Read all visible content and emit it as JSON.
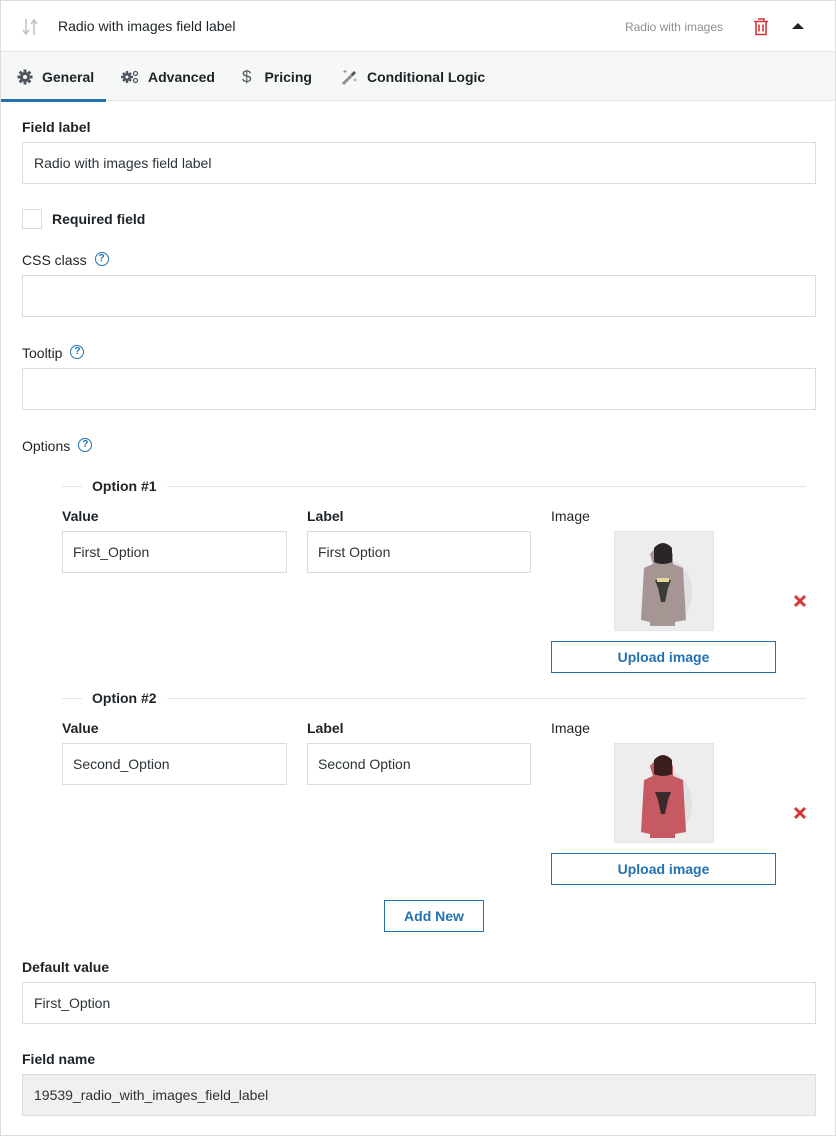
{
  "header": {
    "title": "Radio with images field label",
    "field_type": "Radio with images",
    "icons": {
      "sort": "sort-arrows-icon",
      "delete": "trash-icon",
      "collapse": "caret-up-icon"
    }
  },
  "tabs": [
    {
      "label": "General",
      "icon": "gear-icon",
      "active": true
    },
    {
      "label": "Advanced",
      "icon": "gears-icon",
      "active": false
    },
    {
      "label": "Pricing",
      "icon": "dollar-icon",
      "active": false
    },
    {
      "label": "Conditional Logic",
      "icon": "magic-wand-icon",
      "active": false
    }
  ],
  "form": {
    "field_label": {
      "label": "Field label",
      "value": "Radio with images field label"
    },
    "required": {
      "label": "Required field",
      "checked": false
    },
    "css_class": {
      "label": "CSS class",
      "value": "",
      "help": "?"
    },
    "tooltip": {
      "label": "Tooltip",
      "value": "",
      "help": "?"
    },
    "options": {
      "label": "Options",
      "help": "?",
      "items": [
        {
          "legend": "Option #1",
          "value_label": "Value",
          "value": "First_Option",
          "label_label": "Label",
          "label": "First Option",
          "image_label": "Image",
          "image": "grey hoodie thumbnail",
          "image_color": "#a59593",
          "upload_label": "Upload image"
        },
        {
          "legend": "Option #2",
          "value_label": "Value",
          "value": "Second_Option",
          "label_label": "Label",
          "label": "Second Option",
          "image_label": "Image",
          "image": "red hoodie thumbnail",
          "image_color": "#c65a62",
          "upload_label": "Upload image"
        }
      ],
      "add_new_label": "Add New"
    },
    "default_value": {
      "label": "Default value",
      "value": "First_Option"
    },
    "field_name": {
      "label": "Field name",
      "value": "19539_radio_with_images_field_label"
    }
  },
  "colors": {
    "accent": "#2271b1",
    "danger": "#d63638",
    "text": "#1d2327",
    "muted": "#8c8f94",
    "border": "#dcdcde"
  }
}
